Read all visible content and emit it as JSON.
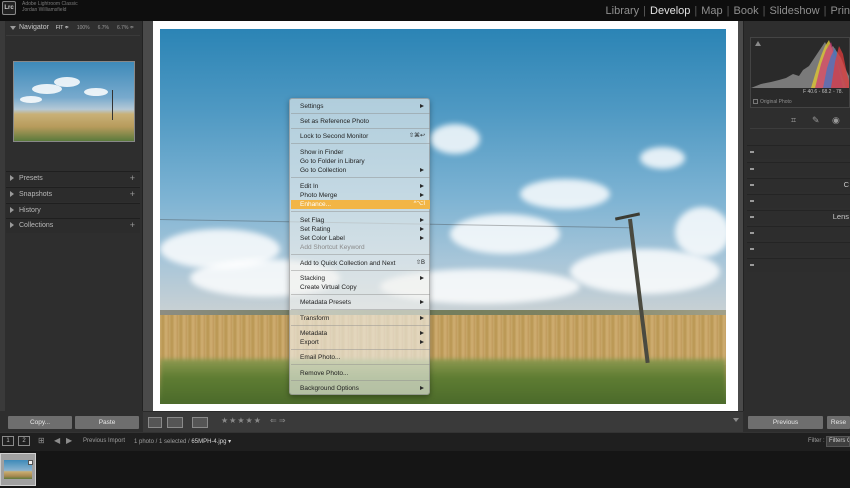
{
  "app": {
    "logo": "Lrc",
    "brand_line1": "Adobe Lightroom Classic",
    "brand_line2": "Jordan Williamsfield"
  },
  "modules": {
    "library": "Library",
    "develop": "Develop",
    "map": "Map",
    "book": "Book",
    "slideshow": "Slideshow",
    "print": "Prin",
    "separator": "|",
    "active": "Develop"
  },
  "navigator": {
    "title": "Navigator",
    "zoom_options": [
      "FIT ≑",
      "100%",
      "6.7%",
      "6.7% ≑"
    ]
  },
  "left_sections": [
    {
      "label": "Presets",
      "has_plus": true
    },
    {
      "label": "Snapshots",
      "has_plus": true
    },
    {
      "label": "History",
      "has_plus": false
    },
    {
      "label": "Collections",
      "has_plus": true
    }
  ],
  "left_plus": "+",
  "left_bottom": {
    "copy": "Copy...",
    "paste": "Paste"
  },
  "context_menu": {
    "settings": "Settings",
    "set_reference": "Set as Reference Photo",
    "lock_monitor": "Lock to Second Monitor",
    "lock_monitor_sc": "⇧⌘↩",
    "show_finder": "Show in Finder",
    "go_folder": "Go to Folder in Library",
    "go_collection": "Go to Collection",
    "edit_in": "Edit In",
    "photo_merge": "Photo Merge",
    "enhance": "Enhance...",
    "enhance_sc": "^⌥I",
    "set_flag": "Set Flag",
    "set_rating": "Set Rating",
    "set_color_label": "Set Color Label",
    "add_shortcut_keyword": "Add Shortcut Keyword",
    "add_quick_collection": "Add to Quick Collection and Next",
    "add_quick_collection_sc": "⇧B",
    "stacking": "Stacking",
    "create_virtual_copy": "Create Virtual Copy",
    "metadata_presets": "Metadata Presets",
    "transform": "Transform",
    "metadata": "Metadata",
    "export": "Export",
    "email_photo": "Email Photo...",
    "remove_photo": "Remove Photo...",
    "background_options": "Background Options"
  },
  "toolbar": {
    "stars": "★★★★★",
    "arrows": "⇐ ⇒"
  },
  "histogram": {
    "values": "F   40.6   ◦  68.2   ◦  78.",
    "original_photo": "Original Photo"
  },
  "right_tools": {
    "crop": "⌗",
    "heal": "✎",
    "redeye": "◉"
  },
  "right_rows": [
    {
      "label": ""
    },
    {
      "label": ""
    },
    {
      "label": "C"
    },
    {
      "label": ""
    },
    {
      "label": "Lens"
    },
    {
      "label": ""
    },
    {
      "label": ""
    },
    {
      "label": ""
    }
  ],
  "right_bottom": {
    "previous": "Previous",
    "reset": "Rese"
  },
  "filmbar": {
    "screen1": "1",
    "screen2": "2",
    "grid_icon": "⊞",
    "back_icon": "◀",
    "forward_icon": "▶",
    "source_label": "Previous Import",
    "count_text": "1 photo / 1 selected /",
    "filename": "65MPH-4.jpg ▾",
    "filter_label": "Filter :",
    "filter_value": "Filters Off"
  },
  "colors": {
    "highlight": "#f2b545",
    "active_module": "#e2e2e2"
  }
}
